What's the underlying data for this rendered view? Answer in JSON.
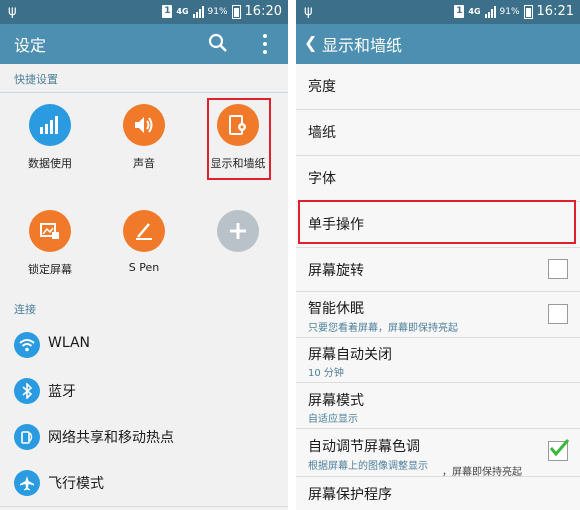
{
  "left": {
    "status": {
      "sim": "1",
      "net": "4G",
      "battery": "91%",
      "time": "16:20"
    },
    "title": "设定",
    "quick_header": "快捷设置",
    "quick": [
      {
        "label": "数据使用",
        "color": "#2a9be0"
      },
      {
        "label": "声音",
        "color": "#f07a2a"
      },
      {
        "label": "显示和墙纸",
        "color": "#f07a2a"
      },
      {
        "label": "锁定屏幕",
        "color": "#f07a2a"
      },
      {
        "label": "S Pen",
        "color": "#f07a2a"
      },
      {
        "label": "",
        "color": "#b8c2c8"
      }
    ],
    "conn_header": "连接",
    "conn": [
      {
        "label": "WLAN"
      },
      {
        "label": "蓝牙"
      },
      {
        "label": "网络共享和移动热点"
      },
      {
        "label": "飞行模式"
      }
    ]
  },
  "right": {
    "status": {
      "sim": "1",
      "net": "4G",
      "battery": "91%",
      "time": "16:21"
    },
    "title": "显示和墙纸",
    "rows": [
      {
        "label": "亮度"
      },
      {
        "label": "墙纸"
      },
      {
        "label": "字体"
      },
      {
        "label": "单手操作"
      },
      {
        "label": "屏幕旋转",
        "checked": false
      },
      {
        "label": "智能休眠",
        "sub": "只要您看着屏幕，屏幕即保持亮起",
        "checked": false
      },
      {
        "label": "屏幕自动关闭",
        "sub": "10 分钟"
      },
      {
        "label": "屏幕模式",
        "sub": "自适应显示"
      },
      {
        "label": "自动调节屏幕色调",
        "sub": "根据屏幕上的图像调整显示",
        "checked": true
      },
      {
        "label": "屏幕保护程序"
      }
    ],
    "overlay": "，屏幕即保持亮起"
  },
  "colors": {
    "statusbar": "#3c6f8a",
    "actionbar": "#4d8fb0",
    "highlight": "#e0202c",
    "check": "#3cb83c"
  }
}
